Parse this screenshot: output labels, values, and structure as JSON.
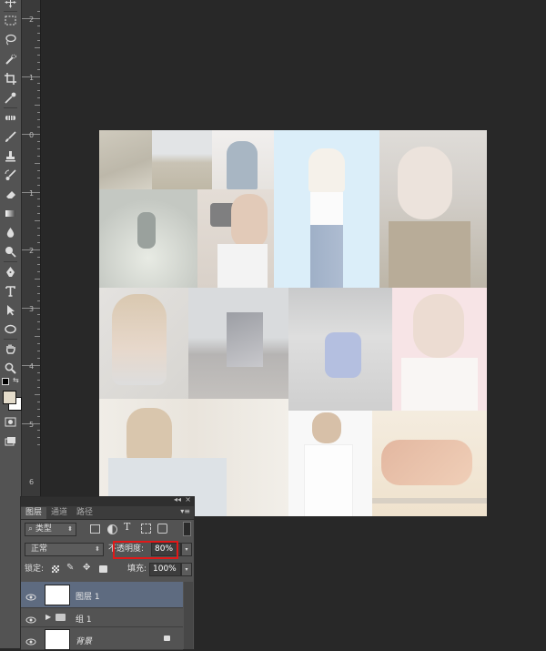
{
  "ruler": {
    "numbers": [
      "2",
      "1",
      "0",
      "1",
      "2",
      "3",
      "4",
      "5",
      "6"
    ]
  },
  "tools": [
    "move-icon",
    "marquee-icon",
    "lasso-icon",
    "quick-select-icon",
    "crop-icon",
    "eyedropper-icon",
    "healing-brush-icon",
    "brush-icon",
    "clone-stamp-icon",
    "history-brush-icon",
    "eraser-icon",
    "gradient-icon",
    "blur-icon",
    "dodge-icon",
    "pen-icon",
    "type-icon",
    "path-select-icon",
    "ellipse-shape-icon",
    "hand-icon",
    "zoom-icon"
  ],
  "colors": {
    "foreground": "#e4dccb",
    "background": "#ffffff",
    "highlight": "#e01919"
  },
  "layers_panel": {
    "tabs": [
      "图层",
      "通道",
      "路径"
    ],
    "filter_kind": "类型",
    "blend_mode": "正常",
    "opacity_label": "不透明度:",
    "opacity_value": "80%",
    "lock_label": "锁定:",
    "fill_label": "填充:",
    "fill_value": "100%",
    "layers": [
      {
        "name": "图层 1",
        "selected": true
      },
      {
        "name": "组 1",
        "type": "group"
      },
      {
        "name": "背景",
        "locked": true
      }
    ]
  }
}
